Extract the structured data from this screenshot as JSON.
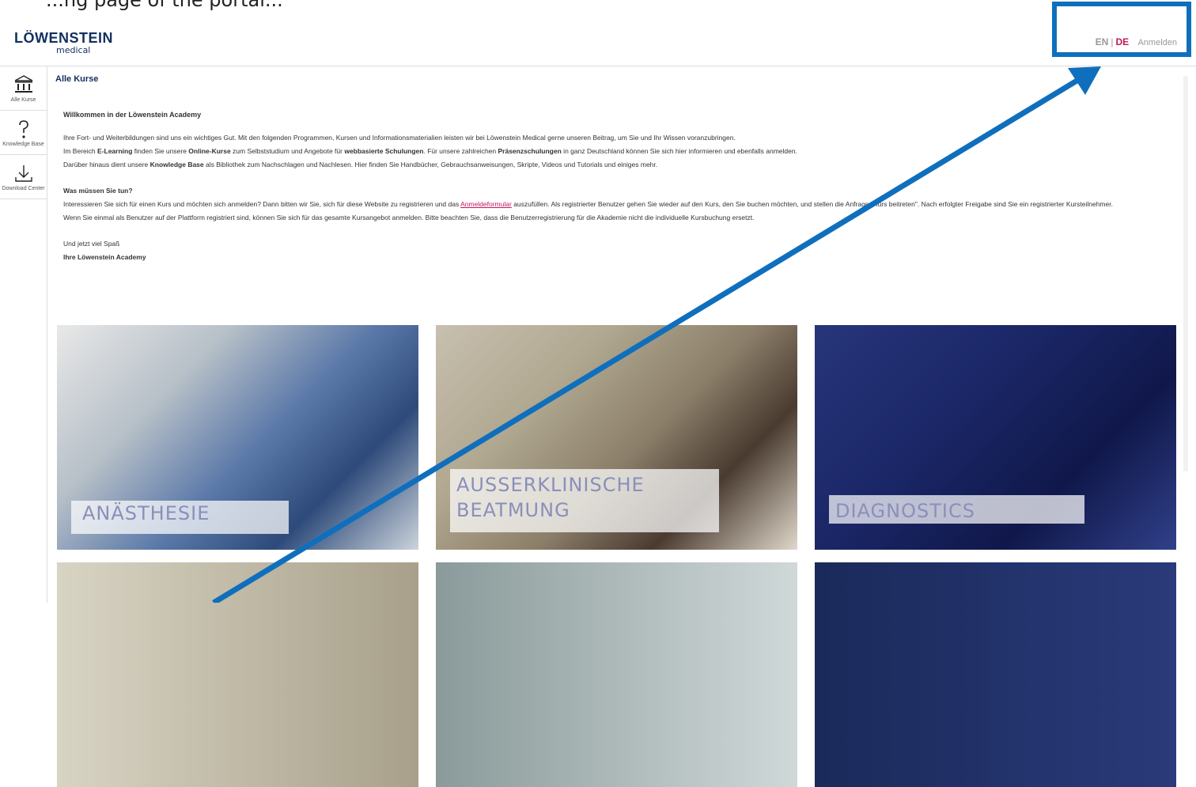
{
  "top_strip": {
    "text": "...ng page of the portal..."
  },
  "header": {
    "logo_main": "LÖWENSTEIN",
    "logo_sub": "medical",
    "lang_en": "EN",
    "lang_sep": "|",
    "lang_de": "DE",
    "login": "Anmelden"
  },
  "sidebar": {
    "items": [
      {
        "label": "Alle Kurse",
        "icon": "bank-icon"
      },
      {
        "label": "Knowledge Base",
        "icon": "question-icon"
      },
      {
        "label": "Download Center",
        "icon": "download-icon"
      }
    ]
  },
  "main": {
    "breadcrumb": "Alle Kurse",
    "welcome": "Willkommen in der Löwenstein Academy",
    "intro_1": "Ihre Fort- und Weiterbildungen sind uns ein wichtiges Gut. Mit den folgenden Programmen, Kursen und Informationsmaterialien leisten wir bei Löwenstein Medical gerne unseren Beitrag, um Sie und Ihr Wissen voranzubringen.",
    "intro_2a": "Im Bereich ",
    "intro_2b": "E-Learning",
    "intro_2c": " finden Sie unsere ",
    "intro_2d": "Online-Kurse",
    "intro_2e": " zum Selbststudium und Angebote für ",
    "intro_2f": "webbasierte Schulungen",
    "intro_2g": ". Für unsere zahlreichen ",
    "intro_2h": "Präsenzschulungen",
    "intro_2i": " in ganz Deutschland können Sie sich hier informieren und ebenfalls anmelden.",
    "intro_3a": "Darüber hinaus dient unsere ",
    "intro_3b": "Knowledge Base",
    "intro_3c": " als Bibliothek zum Nachschlagen und Nachlesen. Hier finden Sie Handbücher, Gebrauchsanweisungen, Skripte, Videos und Tutorials und einiges mehr.",
    "what_title": "Was müssen Sie tun?",
    "what_1a": "Interessieren Sie sich für einen Kurs und möchten sich anmelden? Dann bitten wir Sie, sich für diese Website zu registrieren und das ",
    "what_1_link": "Anmeldeformular",
    "what_1b": " auszufüllen. Als registrierter Benutzer gehen Sie wieder auf den Kurs, den Sie buchen möchten, und stellen die Anfrage \"Kurs beitreten\". Nach erfolgter Freigabe sind Sie ein registrierter Kursteilnehmer.",
    "what_2": "Wenn Sie einmal als Benutzer auf der Plattform registriert sind, können Sie sich für das gesamte Kursangebot anmelden. Bitte beachten Sie, dass die Benutzerregistrierung für die Akademie nicht die individuelle Kursbuchung ersetzt.",
    "closing_1": "Und jetzt viel Spaß",
    "closing_2": "Ihre Löwenstein Academy"
  },
  "courses": [
    {
      "label": "ANÄSTHESIE"
    },
    {
      "label_line1": "AUSSERKLINISCHE",
      "label_line2": "BEATMUNG"
    },
    {
      "label": "DIAGNOSTICS"
    }
  ],
  "colors": {
    "brand": "#12305e",
    "accent": "#c2185b",
    "annotation": "#0f6fbd"
  }
}
